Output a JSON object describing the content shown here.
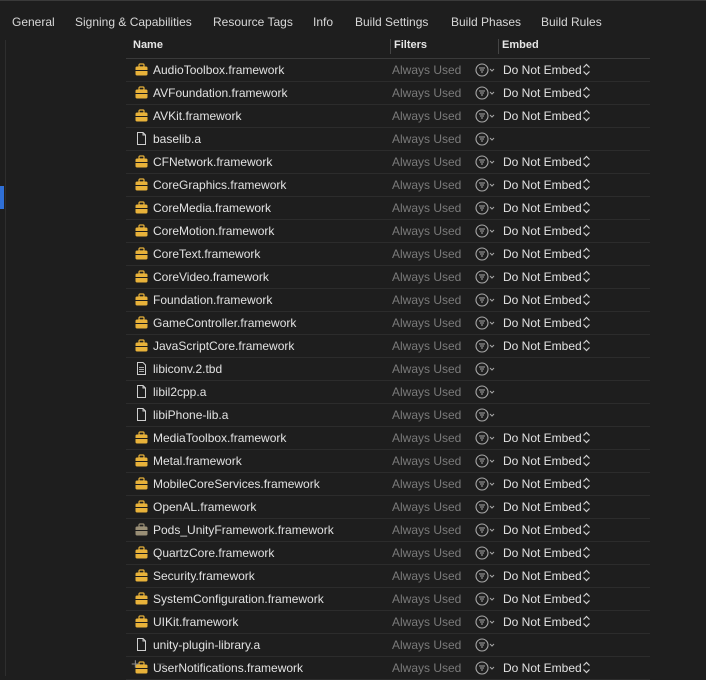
{
  "tabs": [
    {
      "label": "General",
      "active": true
    },
    {
      "label": "Signing & Capabilities"
    },
    {
      "label": "Resource Tags"
    },
    {
      "label": "Info"
    },
    {
      "label": "Build Settings"
    },
    {
      "label": "Build Phases"
    },
    {
      "label": "Build Rules"
    }
  ],
  "table": {
    "columns": {
      "name": "Name",
      "filters": "Filters",
      "embed": "Embed"
    },
    "rows": [
      {
        "name": "AudioToolbox.framework",
        "icon": "framework-icon",
        "filter": "Always Used",
        "embed": "Do Not Embed"
      },
      {
        "name": "AVFoundation.framework",
        "icon": "framework-icon",
        "filter": "Always Used",
        "embed": "Do Not Embed"
      },
      {
        "name": "AVKit.framework",
        "icon": "framework-icon",
        "filter": "Always Used",
        "embed": "Do Not Embed"
      },
      {
        "name": "baselib.a",
        "icon": "file-icon",
        "filter": "Always Used",
        "embed": ""
      },
      {
        "name": "CFNetwork.framework",
        "icon": "framework-icon",
        "filter": "Always Used",
        "embed": "Do Not Embed"
      },
      {
        "name": "CoreGraphics.framework",
        "icon": "framework-icon",
        "filter": "Always Used",
        "embed": "Do Not Embed"
      },
      {
        "name": "CoreMedia.framework",
        "icon": "framework-icon",
        "filter": "Always Used",
        "embed": "Do Not Embed"
      },
      {
        "name": "CoreMotion.framework",
        "icon": "framework-icon",
        "filter": "Always Used",
        "embed": "Do Not Embed"
      },
      {
        "name": "CoreText.framework",
        "icon": "framework-icon",
        "filter": "Always Used",
        "embed": "Do Not Embed"
      },
      {
        "name": "CoreVideo.framework",
        "icon": "framework-icon",
        "filter": "Always Used",
        "embed": "Do Not Embed"
      },
      {
        "name": "Foundation.framework",
        "icon": "framework-icon",
        "filter": "Always Used",
        "embed": "Do Not Embed"
      },
      {
        "name": "GameController.framework",
        "icon": "framework-icon",
        "filter": "Always Used",
        "embed": "Do Not Embed"
      },
      {
        "name": "JavaScriptCore.framework",
        "icon": "framework-icon",
        "filter": "Always Used",
        "embed": "Do Not Embed"
      },
      {
        "name": "libiconv.2.tbd",
        "icon": "tbd-file-icon",
        "filter": "Always Used",
        "embed": ""
      },
      {
        "name": "libil2cpp.a",
        "icon": "file-icon",
        "filter": "Always Used",
        "embed": ""
      },
      {
        "name": "libiPhone-lib.a",
        "icon": "file-icon",
        "filter": "Always Used",
        "embed": ""
      },
      {
        "name": "MediaToolbox.framework",
        "icon": "framework-icon",
        "filter": "Always Used",
        "embed": "Do Not Embed"
      },
      {
        "name": "Metal.framework",
        "icon": "framework-icon",
        "filter": "Always Used",
        "embed": "Do Not Embed"
      },
      {
        "name": "MobileCoreServices.framework",
        "icon": "framework-icon",
        "filter": "Always Used",
        "embed": "Do Not Embed"
      },
      {
        "name": "OpenAL.framework",
        "icon": "framework-icon",
        "filter": "Always Used",
        "embed": "Do Not Embed"
      },
      {
        "name": "Pods_UnityFramework.framework",
        "icon": "framework-gray-icon",
        "filter": "Always Used",
        "embed": "Do Not Embed"
      },
      {
        "name": "QuartzCore.framework",
        "icon": "framework-icon",
        "filter": "Always Used",
        "embed": "Do Not Embed"
      },
      {
        "name": "Security.framework",
        "icon": "framework-icon",
        "filter": "Always Used",
        "embed": "Do Not Embed"
      },
      {
        "name": "SystemConfiguration.framework",
        "icon": "framework-icon",
        "filter": "Always Used",
        "embed": "Do Not Embed"
      },
      {
        "name": "UIKit.framework",
        "icon": "framework-icon",
        "filter": "Always Used",
        "embed": "Do Not Embed"
      },
      {
        "name": "unity-plugin-library.a",
        "icon": "file-icon",
        "filter": "Always Used",
        "embed": ""
      },
      {
        "name": "UserNotifications.framework",
        "icon": "framework-icon",
        "filter": "Always Used",
        "embed": "Do Not Embed"
      }
    ]
  },
  "footer": {
    "add": "+",
    "remove": "−"
  },
  "colors": {
    "accent": "#2f6fd6",
    "active_tab": "#3b5372",
    "framework_icon": "#e8b23a",
    "muted": "#7a7a7a"
  }
}
